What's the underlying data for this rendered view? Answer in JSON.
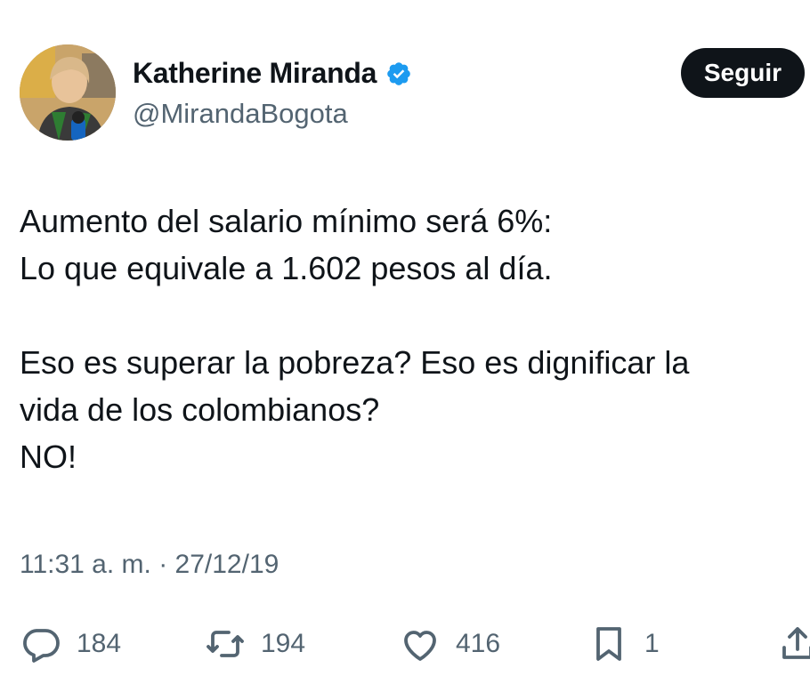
{
  "author": {
    "display_name": "Katherine Miranda",
    "handle": "@MirandaBogota",
    "verified": true
  },
  "follow_button": {
    "label": "Seguir"
  },
  "tweet": {
    "lines": [
      "Aumento del salario mínimo será 6%:",
      "Lo que equivale a 1.602 pesos al día.",
      "",
      "Eso es superar la pobreza? Eso es dignificar la",
      "vida de los colombianos?",
      "NO!"
    ],
    "time": "11:31 a. m.",
    "separator": " · ",
    "date": "27/12/19"
  },
  "actions": {
    "replies": "184",
    "retweets": "194",
    "likes": "416",
    "bookmarks": "1"
  },
  "colors": {
    "text": "#0f1419",
    "muted": "#536471",
    "verified_blue": "#1d9bf0",
    "button_bg": "#0f1419",
    "button_text": "#ffffff"
  },
  "icons": {
    "reply": "speech-bubble-icon",
    "retweet": "retweet-arrows-icon",
    "like": "heart-icon",
    "bookmark": "bookmark-icon",
    "share": "share-upload-icon",
    "verified": "verified-badge-icon"
  }
}
